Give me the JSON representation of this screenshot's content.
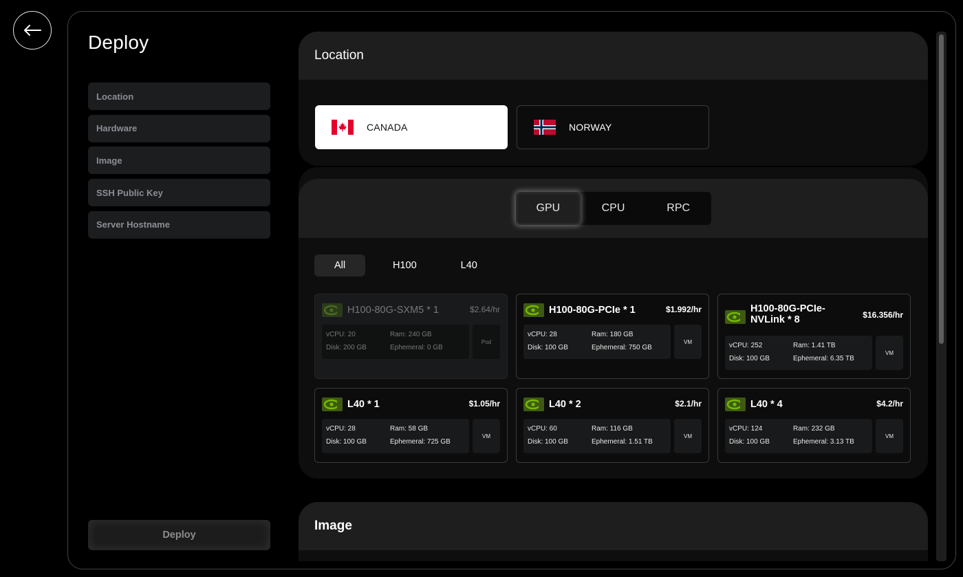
{
  "back": {
    "icon": "arrow-left-icon"
  },
  "sidebar": {
    "title": "Deploy",
    "items": [
      {
        "label": "Location"
      },
      {
        "label": "Hardware"
      },
      {
        "label": "Image"
      },
      {
        "label": "SSH Public Key"
      },
      {
        "label": "Server Hostname"
      }
    ],
    "deploy_label": "Deploy"
  },
  "location": {
    "title": "Location",
    "options": [
      {
        "label": "CANADA",
        "flag": "canada-flag-icon",
        "selected": true
      },
      {
        "label": "NORWAY",
        "flag": "norway-flag-icon",
        "selected": false
      }
    ]
  },
  "hardware": {
    "tabs": [
      {
        "label": "GPU",
        "active": true
      },
      {
        "label": "CPU",
        "active": false
      },
      {
        "label": "RPC",
        "active": false
      }
    ],
    "filters": [
      {
        "label": "All",
        "active": true
      },
      {
        "label": "H100",
        "active": false
      },
      {
        "label": "L40",
        "active": false
      }
    ],
    "cards": [
      {
        "name": "H100-80G-SXM5 * 1",
        "price": "$2.64/hr",
        "vcpu": "vCPU: 20",
        "ram": "Ram: 240 GB",
        "disk": "Disk: 200 GB",
        "ephemeral": "Ephemeral: 0 GB",
        "type": "Pod",
        "disabled": true
      },
      {
        "name": "H100-80G-PCIe * 1",
        "price": "$1.992/hr",
        "vcpu": "vCPU: 28",
        "ram": "Ram: 180 GB",
        "disk": "Disk: 100 GB",
        "ephemeral": "Ephemeral: 750 GB",
        "type": "VM",
        "disabled": false
      },
      {
        "name": "H100-80G-PCIe-NVLink * 8",
        "price": "$16.356/hr",
        "vcpu": "vCPU: 252",
        "ram": "Ram: 1.41 TB",
        "disk": "Disk: 100 GB",
        "ephemeral": "Ephemeral: 6.35 TB",
        "type": "VM",
        "disabled": false
      },
      {
        "name": "L40 * 1",
        "price": "$1.05/hr",
        "vcpu": "vCPU: 28",
        "ram": "Ram: 58 GB",
        "disk": "Disk: 100 GB",
        "ephemeral": "Ephemeral: 725 GB",
        "type": "VM",
        "disabled": false
      },
      {
        "name": "L40 * 2",
        "price": "$2.1/hr",
        "vcpu": "vCPU: 60",
        "ram": "Ram: 116 GB",
        "disk": "Disk: 100 GB",
        "ephemeral": "Ephemeral: 1.51 TB",
        "type": "VM",
        "disabled": false
      },
      {
        "name": "L40 * 4",
        "price": "$4.2/hr",
        "vcpu": "vCPU: 124",
        "ram": "Ram: 232 GB",
        "disk": "Disk: 100 GB",
        "ephemeral": "Ephemeral: 3.13 TB",
        "type": "VM",
        "disabled": false
      }
    ],
    "vendor_icon": "nvidia-icon"
  },
  "image": {
    "title": "Image"
  },
  "colors": {
    "background": "#000000",
    "panel": "#0e0e0e",
    "panel_header": "#1e1e1e",
    "nvidia_green": "#76b900"
  }
}
